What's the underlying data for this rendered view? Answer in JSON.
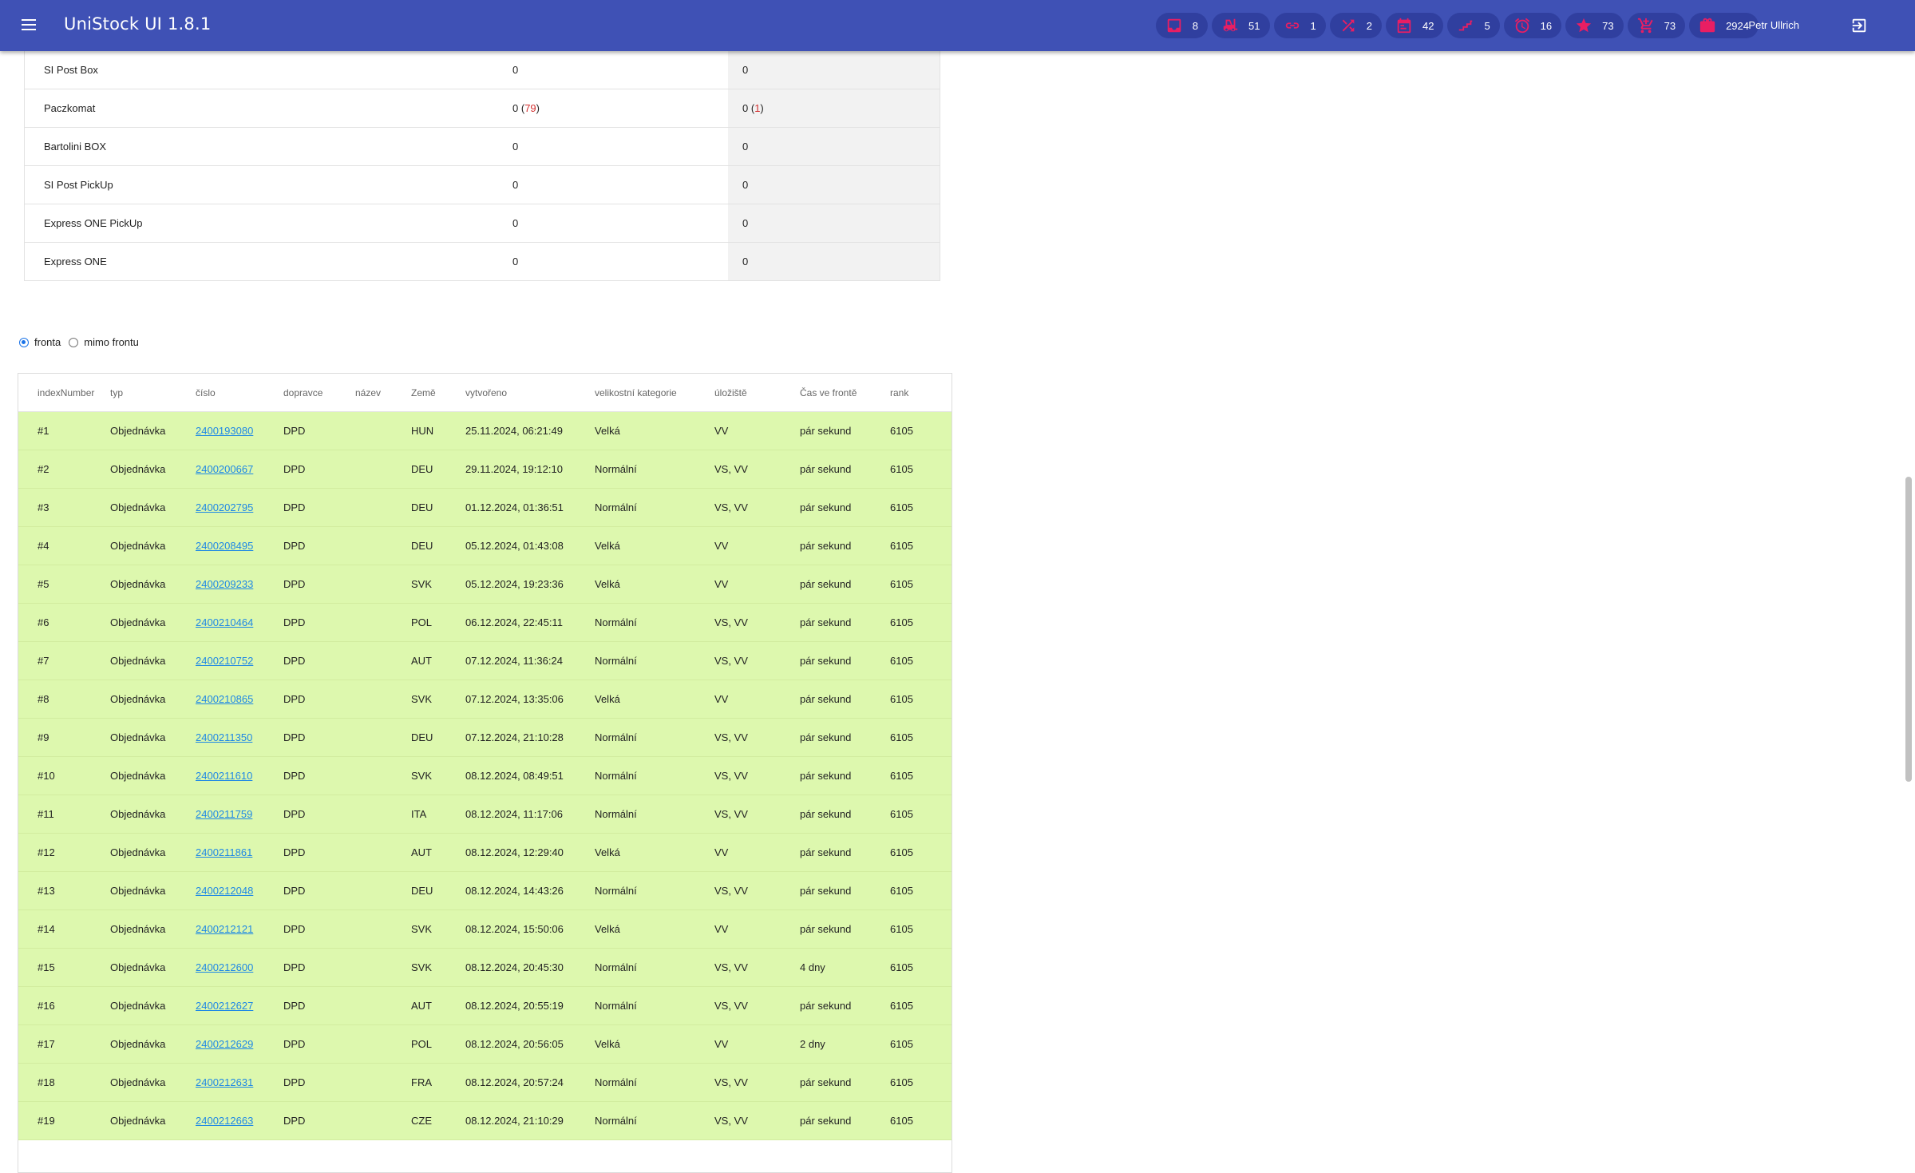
{
  "app": {
    "title": "UniStock UI 1.8.1",
    "user": "Petr Ullrich",
    "accent": "#e91e63",
    "bar_color": "#3f51b5"
  },
  "chips": [
    {
      "icon": "inbox-icon",
      "count": "8"
    },
    {
      "icon": "forklift-icon",
      "count": "51"
    },
    {
      "icon": "link-icon",
      "count": "1"
    },
    {
      "icon": "shuffle-icon",
      "count": "2"
    },
    {
      "icon": "calendar-icon",
      "count": "42"
    },
    {
      "icon": "stairs-icon",
      "count": "5"
    },
    {
      "icon": "alarm-icon",
      "count": "16"
    },
    {
      "icon": "star-icon",
      "count": "73"
    },
    {
      "icon": "cart-icon",
      "count": "73"
    },
    {
      "icon": "package-icon",
      "count": "2924"
    }
  ],
  "summary": [
    {
      "name": "SI Post Box",
      "v1": "0",
      "v1_extra": "",
      "v2": "0",
      "v2_extra": ""
    },
    {
      "name": "Paczkomat",
      "v1": "0",
      "v1_extra": "79",
      "v2": "0",
      "v2_extra": "1"
    },
    {
      "name": "Bartolini BOX",
      "v1": "0",
      "v1_extra": "",
      "v2": "0",
      "v2_extra": ""
    },
    {
      "name": "SI Post PickUp",
      "v1": "0",
      "v1_extra": "",
      "v2": "0",
      "v2_extra": ""
    },
    {
      "name": "Express ONE PickUp",
      "v1": "0",
      "v1_extra": "",
      "v2": "0",
      "v2_extra": ""
    },
    {
      "name": "Express ONE",
      "v1": "0",
      "v1_extra": "",
      "v2": "0",
      "v2_extra": ""
    }
  ],
  "radios": {
    "queue": "fronta",
    "outside": "mimo frontu",
    "selected": "queue"
  },
  "queue": {
    "headers": [
      "indexNumber",
      "typ",
      "číslo",
      "dopravce",
      "název",
      "Země",
      "vytvořeno",
      "velikostní kategorie",
      "úložiště",
      "Čas ve frontě",
      "rank"
    ],
    "rows": [
      [
        "#1",
        "Objednávka",
        "2400193080",
        "DPD",
        "",
        "HUN",
        "25.11.2024, 06:21:49",
        "Velká",
        "VV",
        "pár sekund",
        "6105"
      ],
      [
        "#2",
        "Objednávka",
        "2400200667",
        "DPD",
        "",
        "DEU",
        "29.11.2024, 19:12:10",
        "Normální",
        "VS, VV",
        "pár sekund",
        "6105"
      ],
      [
        "#3",
        "Objednávka",
        "2400202795",
        "DPD",
        "",
        "DEU",
        "01.12.2024, 01:36:51",
        "Normální",
        "VS, VV",
        "pár sekund",
        "6105"
      ],
      [
        "#4",
        "Objednávka",
        "2400208495",
        "DPD",
        "",
        "DEU",
        "05.12.2024, 01:43:08",
        "Velká",
        "VV",
        "pár sekund",
        "6105"
      ],
      [
        "#5",
        "Objednávka",
        "2400209233",
        "DPD",
        "",
        "SVK",
        "05.12.2024, 19:23:36",
        "Velká",
        "VV",
        "pár sekund",
        "6105"
      ],
      [
        "#6",
        "Objednávka",
        "2400210464",
        "DPD",
        "",
        "POL",
        "06.12.2024, 22:45:11",
        "Normální",
        "VS, VV",
        "pár sekund",
        "6105"
      ],
      [
        "#7",
        "Objednávka",
        "2400210752",
        "DPD",
        "",
        "AUT",
        "07.12.2024, 11:36:24",
        "Normální",
        "VS, VV",
        "pár sekund",
        "6105"
      ],
      [
        "#8",
        "Objednávka",
        "2400210865",
        "DPD",
        "",
        "SVK",
        "07.12.2024, 13:35:06",
        "Velká",
        "VV",
        "pár sekund",
        "6105"
      ],
      [
        "#9",
        "Objednávka",
        "2400211350",
        "DPD",
        "",
        "DEU",
        "07.12.2024, 21:10:28",
        "Normální",
        "VS, VV",
        "pár sekund",
        "6105"
      ],
      [
        "#10",
        "Objednávka",
        "2400211610",
        "DPD",
        "",
        "SVK",
        "08.12.2024, 08:49:51",
        "Normální",
        "VS, VV",
        "pár sekund",
        "6105"
      ],
      [
        "#11",
        "Objednávka",
        "2400211759",
        "DPD",
        "",
        "ITA",
        "08.12.2024, 11:17:06",
        "Normální",
        "VS, VV",
        "pár sekund",
        "6105"
      ],
      [
        "#12",
        "Objednávka",
        "2400211861",
        "DPD",
        "",
        "AUT",
        "08.12.2024, 12:29:40",
        "Velká",
        "VV",
        "pár sekund",
        "6105"
      ],
      [
        "#13",
        "Objednávka",
        "2400212048",
        "DPD",
        "",
        "DEU",
        "08.12.2024, 14:43:26",
        "Normální",
        "VS, VV",
        "pár sekund",
        "6105"
      ],
      [
        "#14",
        "Objednávka",
        "2400212121",
        "DPD",
        "",
        "SVK",
        "08.12.2024, 15:50:06",
        "Velká",
        "VV",
        "pár sekund",
        "6105"
      ],
      [
        "#15",
        "Objednávka",
        "2400212600",
        "DPD",
        "",
        "SVK",
        "08.12.2024, 20:45:30",
        "Normální",
        "VS, VV",
        "4 dny",
        "6105"
      ],
      [
        "#16",
        "Objednávka",
        "2400212627",
        "DPD",
        "",
        "AUT",
        "08.12.2024, 20:55:19",
        "Normální",
        "VS, VV",
        "pár sekund",
        "6105"
      ],
      [
        "#17",
        "Objednávka",
        "2400212629",
        "DPD",
        "",
        "POL",
        "08.12.2024, 20:56:05",
        "Velká",
        "VV",
        "2 dny",
        "6105"
      ],
      [
        "#18",
        "Objednávka",
        "2400212631",
        "DPD",
        "",
        "FRA",
        "08.12.2024, 20:57:24",
        "Normální",
        "VS, VV",
        "pár sekund",
        "6105"
      ],
      [
        "#19",
        "Objednávka",
        "2400212663",
        "DPD",
        "",
        "CZE",
        "08.12.2024, 21:10:29",
        "Normální",
        "VS, VV",
        "pár sekund",
        "6105"
      ]
    ]
  }
}
